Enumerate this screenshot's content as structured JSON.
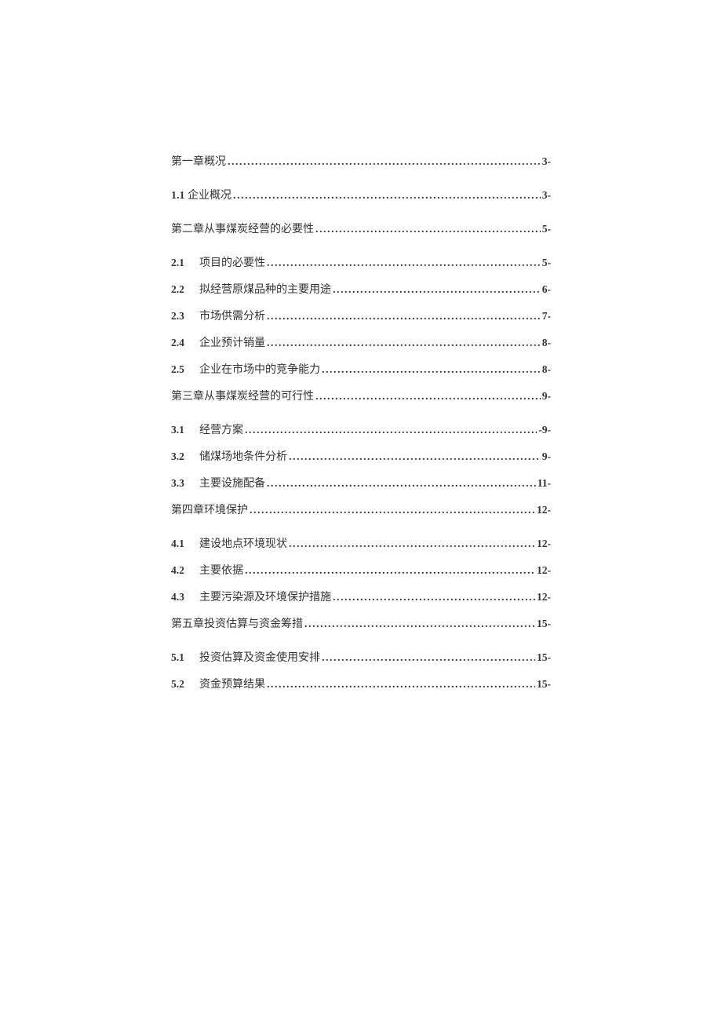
{
  "toc": [
    {
      "type": "chapter",
      "num": "",
      "title": "第一章概况",
      "page": "3-",
      "leadspace": false
    },
    {
      "type": "sub_inline",
      "num": "1.1",
      "title": "企业概况",
      "page": "3-"
    },
    {
      "type": "chapter",
      "num": "",
      "title": "第二章从事煤炭经营的必要性",
      "page": "5-",
      "leadspace": false
    },
    {
      "type": "sub",
      "num": "2.1",
      "title": "项目的必要性",
      "page": "5-"
    },
    {
      "type": "sub",
      "num": "2.2",
      "title": "拟经营原煤品种的主要用途",
      "page": "6-"
    },
    {
      "type": "sub",
      "num": "2.3",
      "title": "市场供需分析",
      "page": "7-"
    },
    {
      "type": "sub",
      "num": "2.4",
      "title": "企业预计销量",
      "page": "8-"
    },
    {
      "type": "sub",
      "num": "2.5",
      "title": "企业在市场中的竞争能力",
      "page": "8-"
    },
    {
      "type": "chapter",
      "num": "",
      "title": "第三章从事煤炭经营的可行性",
      "page": "9-",
      "leadspace": false
    },
    {
      "type": "sub",
      "num": "3.1",
      "title": "经营方案",
      "page": "-9-"
    },
    {
      "type": "sub",
      "num": "3.2",
      "title": "储煤场地条件分析",
      "page": "9-"
    },
    {
      "type": "sub",
      "num": "3.3",
      "title": "主要设施配备",
      "page": "11-"
    },
    {
      "type": "chapter",
      "num": "",
      "title": "第四章环境保护",
      "page": "12-",
      "leadspace": false
    },
    {
      "type": "sub",
      "num": "4.1",
      "title": "建设地点环境现状",
      "page": "12-"
    },
    {
      "type": "sub",
      "num": "4.2",
      "title": "主要依据",
      "page": "12-"
    },
    {
      "type": "sub",
      "num": "4.3",
      "title": "主要污染源及环境保护措施",
      "page": "12-"
    },
    {
      "type": "chapter",
      "num": "",
      "title": "第五章投资估算与资金筹措",
      "page": "15-",
      "leadspace": false
    },
    {
      "type": "sub",
      "num": "5.1",
      "title": "投资估算及资金使用安排",
      "page": "15-"
    },
    {
      "type": "sub",
      "num": "5.2",
      "title": "资金预算结果",
      "page": "15-"
    }
  ]
}
